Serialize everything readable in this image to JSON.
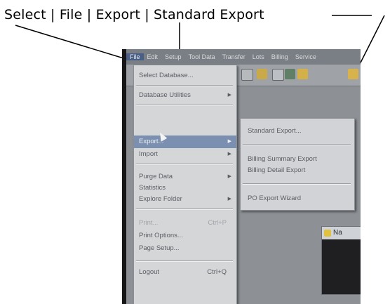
{
  "caption": "Select | File | Export | Standard Export",
  "menubar": {
    "items": [
      "File",
      "Edit",
      "Setup",
      "Tool Data",
      "Transfer",
      "Lots",
      "Billing",
      "Service"
    ]
  },
  "file_menu": {
    "select_database": "Select Database...",
    "database_utilities": "Database Utilities",
    "export": "Export...",
    "import": "Import",
    "purge_data": "Purge Data",
    "statistics": "Statistics",
    "explore_folder": "Explore Folder",
    "print": "Print...",
    "print_shortcut": "Ctrl+P",
    "print_options": "Print Options...",
    "page_setup": "Page Setup...",
    "logout": "Logout",
    "logout_shortcut": "Ctrl+Q"
  },
  "export_submenu": {
    "standard_export": "Standard Export...",
    "billing_summary_export": "Billing Summary Export",
    "billing_detail_export": "Billing Detail Export",
    "po_export_wizard": "PO Export Wizard"
  },
  "background_window": {
    "title": "Na"
  },
  "colors": {
    "menu_highlight": "#7b8fb0",
    "menubar_active": "#4a5f85"
  }
}
